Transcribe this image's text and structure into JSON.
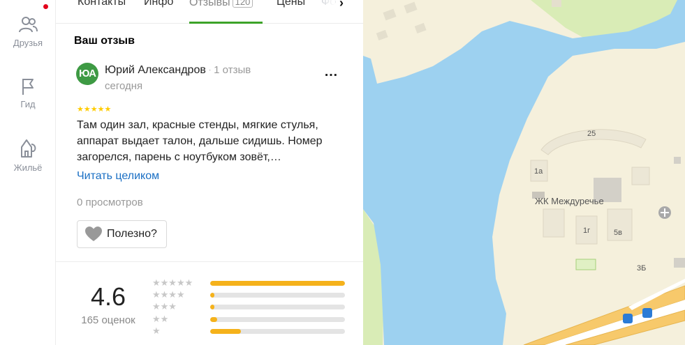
{
  "sidebar": {
    "items": [
      {
        "label": "Друзья",
        "icon": "friends-icon"
      },
      {
        "label": "Гид",
        "icon": "flag-icon"
      },
      {
        "label": "Жильё",
        "icon": "house-icon"
      }
    ]
  },
  "tabs": {
    "items": [
      "Контакты",
      "Инфо",
      "Отзывы",
      "Цены",
      "Фо"
    ],
    "active_count": "120"
  },
  "review": {
    "section_title": "Ваш отзыв",
    "avatar_initials": "ЮА",
    "author": "Юрий Александров",
    "author_reviews": "1 отзыв",
    "date": "сегодня",
    "stars": "★★★★★",
    "text": "Там один зал, красные стенды, мягкие стулья, аппарат выдает талон, дальше сидишь. Номер загорелся, парень с ноутбуком зовёт,…",
    "read_more": "Читать целиком",
    "views": "0 просмотров",
    "useful_label": "Полезно?",
    "more_label": "…"
  },
  "summary": {
    "rating": "4.6",
    "ratings_count": "165 оценок",
    "distribution": [
      {
        "stars": "★★★★★",
        "fraction": 1.0
      },
      {
        "stars": "★★★★",
        "fraction": 0.03
      },
      {
        "stars": "★★★",
        "fraction": 0.03
      },
      {
        "stars": "★★",
        "fraction": 0.05
      },
      {
        "stars": "★",
        "fraction": 0.23
      }
    ]
  },
  "map": {
    "labels": [
      "25",
      "1а",
      "ЖК Междуречье",
      "1г",
      "5в",
      "3Б"
    ],
    "colors": {
      "water": "#9dd1f0",
      "land": "#f5f0dc",
      "park": "#d9ecb6",
      "building": "#e9e4d2"
    }
  },
  "colors": {
    "accent": "#3ca328",
    "link": "#1a6fc4",
    "star": "#fc0",
    "bar": "#f5b21b"
  }
}
